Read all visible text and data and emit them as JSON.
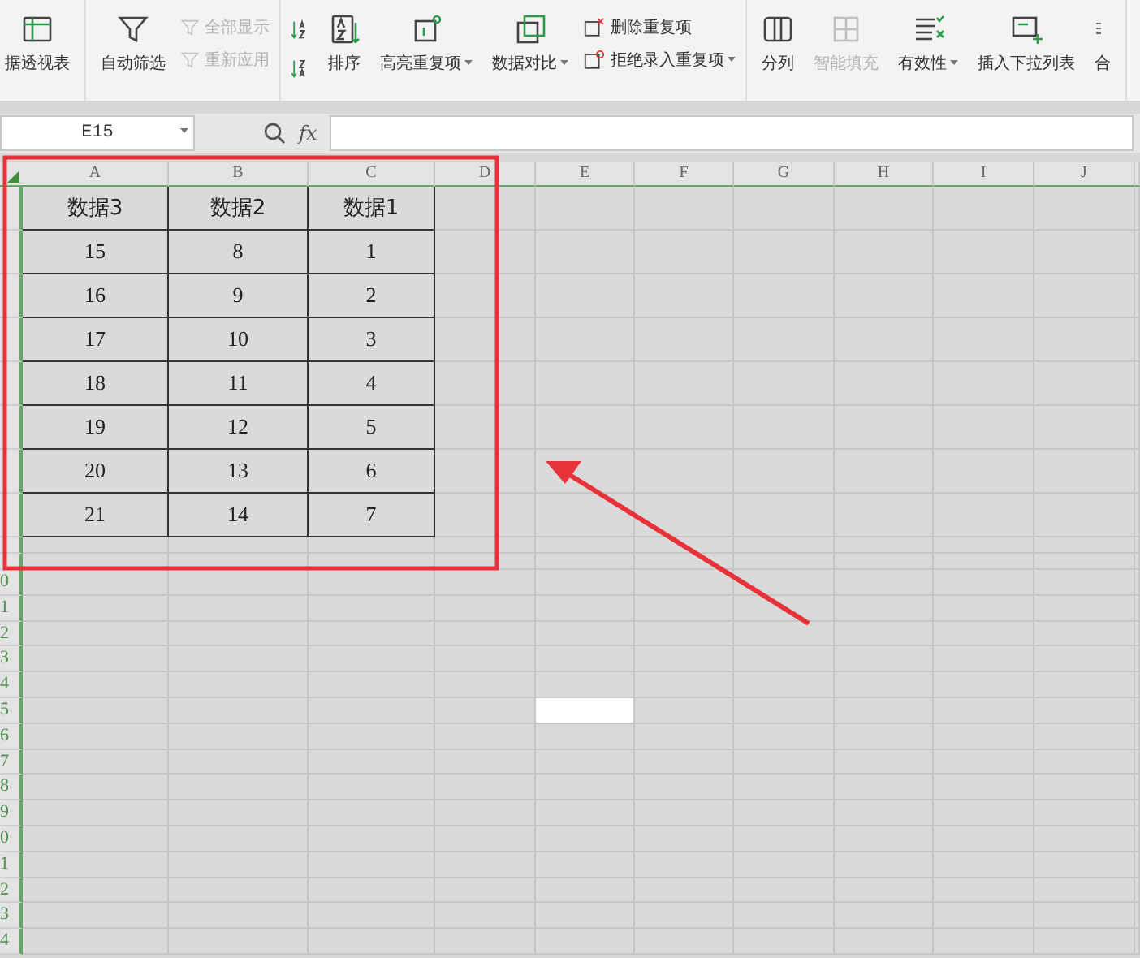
{
  "toolbar": {
    "groups": [
      {
        "items": [
          {
            "kind": "large",
            "label": "据透视表",
            "disabled": false,
            "dropdown": false
          }
        ]
      },
      {
        "items": [
          {
            "kind": "large",
            "label": "自动筛选",
            "disabled": false,
            "dropdown": false
          },
          {
            "kind": "stack",
            "items": [
              {
                "label": "全部显示",
                "disabled": true,
                "dropdown": false
              },
              {
                "label": "重新应用",
                "disabled": true,
                "dropdown": false
              }
            ]
          }
        ]
      },
      {
        "items": [
          {
            "kind": "stack",
            "items": [
              {
                "disabled": false,
                "dropdown": false
              },
              {
                "disabled": false,
                "dropdown": false
              }
            ]
          },
          {
            "kind": "large",
            "label": "排序",
            "disabled": false,
            "dropdown": false
          },
          {
            "kind": "large",
            "label": "高亮重复项",
            "disabled": false,
            "dropdown": true
          },
          {
            "kind": "large",
            "label": "数据对比",
            "disabled": false,
            "dropdown": true
          },
          {
            "kind": "stack",
            "items": [
              {
                "label": "删除重复项",
                "disabled": false,
                "dropdown": false
              },
              {
                "label": "拒绝录入重复项",
                "disabled": false,
                "dropdown": true
              }
            ]
          }
        ]
      },
      {
        "items": [
          {
            "kind": "large",
            "label": "分列",
            "disabled": false,
            "dropdown": false
          },
          {
            "kind": "large",
            "label": "智能填充",
            "disabled": true,
            "dropdown": false
          },
          {
            "kind": "large",
            "label": "有效性",
            "disabled": false,
            "dropdown": true
          },
          {
            "kind": "large",
            "label": "插入下拉列表",
            "disabled": false,
            "dropdown": false
          },
          {
            "kind": "large",
            "label": "合",
            "disabled": false,
            "dropdown": false
          }
        ]
      }
    ]
  },
  "formula_bar": {
    "name_box": "E15",
    "fx_label": "fx"
  },
  "sheet": {
    "columns": [
      "A",
      "B",
      "C",
      "D",
      "E",
      "F",
      "G",
      "H",
      "I",
      "J"
    ],
    "table_rows": [
      [
        "数据3",
        "数据2",
        "数据1"
      ],
      [
        "15",
        "8",
        "1"
      ],
      [
        "16",
        "9",
        "2"
      ],
      [
        "17",
        "10",
        "3"
      ],
      [
        "18",
        "11",
        "4"
      ],
      [
        "19",
        "12",
        "5"
      ],
      [
        "20",
        "13",
        "6"
      ],
      [
        "21",
        "14",
        "7"
      ]
    ],
    "lower_rows": [
      {
        "label": "0",
        "selected": false
      },
      {
        "label": "1",
        "selected": false
      },
      {
        "label": "2",
        "selected": false
      },
      {
        "label": "3",
        "selected": false
      },
      {
        "label": "4",
        "selected": false
      },
      {
        "label": "5",
        "selected": true
      },
      {
        "label": "6",
        "selected": false
      },
      {
        "label": "7",
        "selected": false
      },
      {
        "label": "8",
        "selected": false
      },
      {
        "label": "9",
        "selected": false
      },
      {
        "label": "0",
        "selected": false
      },
      {
        "label": "1",
        "selected": false
      },
      {
        "label": "2",
        "selected": false
      },
      {
        "label": "3",
        "selected": false
      },
      {
        "label": "4",
        "selected": false
      }
    ]
  }
}
